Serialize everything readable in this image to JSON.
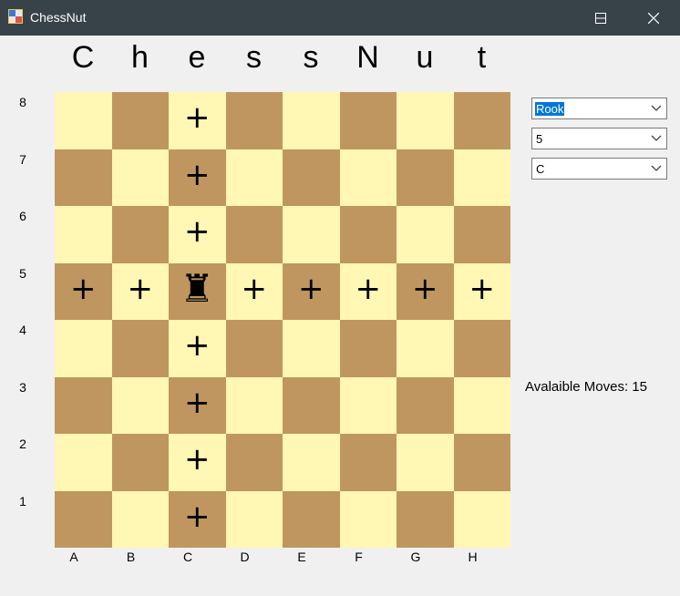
{
  "window": {
    "title": "ChessNut"
  },
  "heading": [
    "C",
    "h",
    "e",
    "s",
    "s",
    "N",
    "u",
    "t"
  ],
  "ranks": [
    "8",
    "7",
    "6",
    "5",
    "4",
    "3",
    "2",
    "1"
  ],
  "files": [
    "A",
    "B",
    "C",
    "D",
    "E",
    "F",
    "G",
    "H"
  ],
  "board": {
    "piece": {
      "name": "Rook",
      "glyph": "♜",
      "file": "C",
      "rank": "5"
    },
    "move_marker_glyph": "+",
    "move_targets": [
      "C8",
      "C7",
      "C6",
      "A5",
      "B5",
      "D5",
      "E5",
      "F5",
      "G5",
      "H5",
      "C4",
      "C3",
      "C2",
      "C1"
    ],
    "colors": {
      "light": "#fff7b3",
      "dark": "#bf9660"
    }
  },
  "controls": {
    "piece_select": {
      "value": "Rook"
    },
    "rank_select": {
      "value": "5"
    },
    "file_select": {
      "value": "C"
    }
  },
  "moves_text": "Avalaible Moves: 15"
}
